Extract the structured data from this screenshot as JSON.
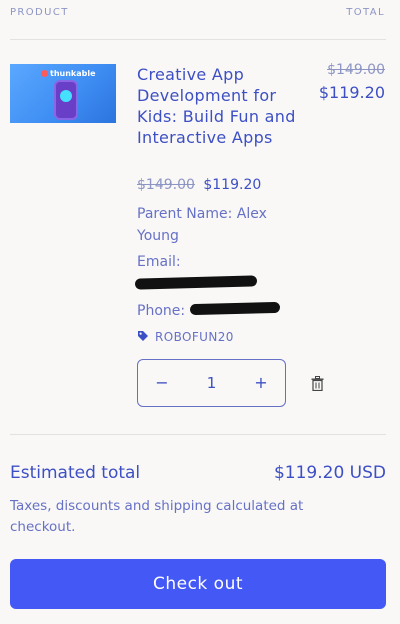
{
  "header": {
    "product_label": "PRODUCT",
    "total_label": "TOTAL"
  },
  "item": {
    "thumb_logo": "thunkable",
    "title": "Creative App Development for Kids: Build Fun and Interactive Apps",
    "original_price": "$149.00",
    "sale_price": "$119.20",
    "line_original": "$149.00",
    "line_total": "$119.20",
    "parent_name": "Parent Name: Alex Young",
    "email_label": "Email:",
    "phone_label": "Phone:",
    "discount_code": "ROBOFUN20",
    "quantity": "1",
    "minus": "−",
    "plus": "+"
  },
  "summary": {
    "estimated_label": "Estimated total",
    "estimated_value": "$119.20 USD",
    "note": "Taxes, discounts and shipping calculated at checkout."
  },
  "checkout": {
    "label": "Check out"
  },
  "colors": {
    "accent": "#4458f5",
    "text": "#3d4fc4",
    "muted": "#8d95c4",
    "background": "#f9f8f6"
  }
}
